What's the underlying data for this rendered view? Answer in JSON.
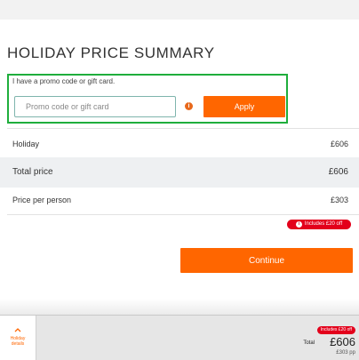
{
  "title": "HOLIDAY PRICE SUMMARY",
  "promo": {
    "label": "I have a promo code or gift card.",
    "placeholder": "Promo code or gift card",
    "value": "",
    "info_icon": "info-icon",
    "apply_label": "Apply"
  },
  "rows": [
    {
      "label": "Holiday",
      "value": "£606"
    },
    {
      "label": "Total price",
      "value": "£606"
    },
    {
      "label": "Price per person",
      "value": "£303"
    }
  ],
  "discount_badge": "Includes £20 off",
  "continue_label": "Continue",
  "footer": {
    "tab_label_line1": "Holiday",
    "tab_label_line2": "details",
    "tab_icon": "chevron-up-icon",
    "badge": "Includes £20 off",
    "total_label": "Total",
    "total_value": "£606",
    "per_person": "£303 pp"
  },
  "colors": {
    "accent": "#ff6600",
    "highlight_border": "#1fae3c",
    "badge": "#e3001b",
    "row_shade": "#eef0f2"
  }
}
